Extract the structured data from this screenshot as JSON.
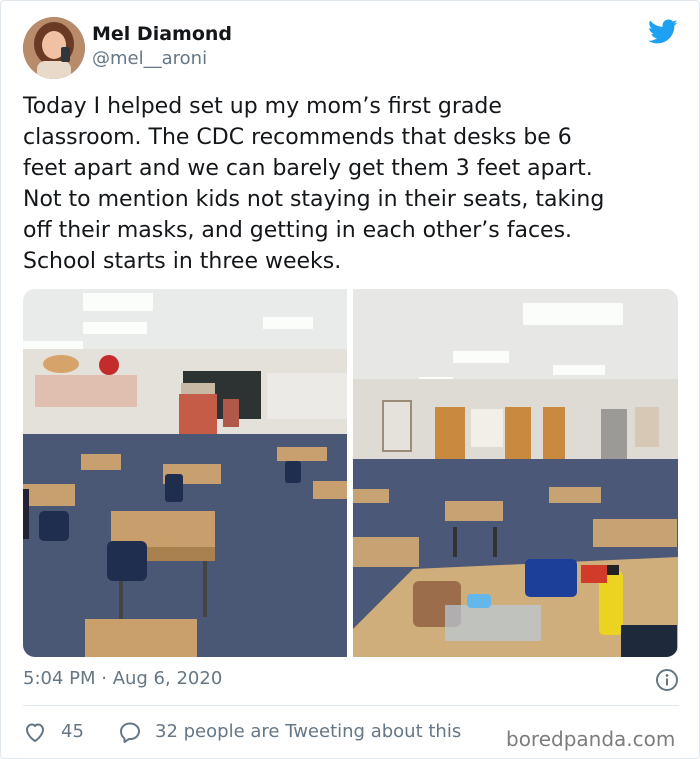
{
  "author": {
    "name": "Mel Diamond",
    "handle": "@mel__aroni"
  },
  "tweet": {
    "lines": [
      "Today I helped set up my mom’s first grade",
      "classroom. The CDC recommends that desks be 6",
      "feet apart and we can barely get them 3 feet apart.",
      "Not to mention kids not staying in their seats, taking",
      "off their masks, and getting in each other’s faces.",
      "School starts in three weeks."
    ],
    "timestamp": "5:04 PM · Aug 6, 2020"
  },
  "engagement": {
    "likes": "45",
    "retweet_text": "32 people are Tweeting about this"
  },
  "watermark": "boredpanda.com",
  "icons": {
    "brand": "twitter-bird-icon",
    "info": "info-icon",
    "like": "heart-icon",
    "reply": "speech-bubble-icon"
  },
  "colors": {
    "twitter_blue": "#1da1f2",
    "secondary_text": "#657786",
    "primary_text": "#14171a",
    "border": "#e1e8ed"
  }
}
